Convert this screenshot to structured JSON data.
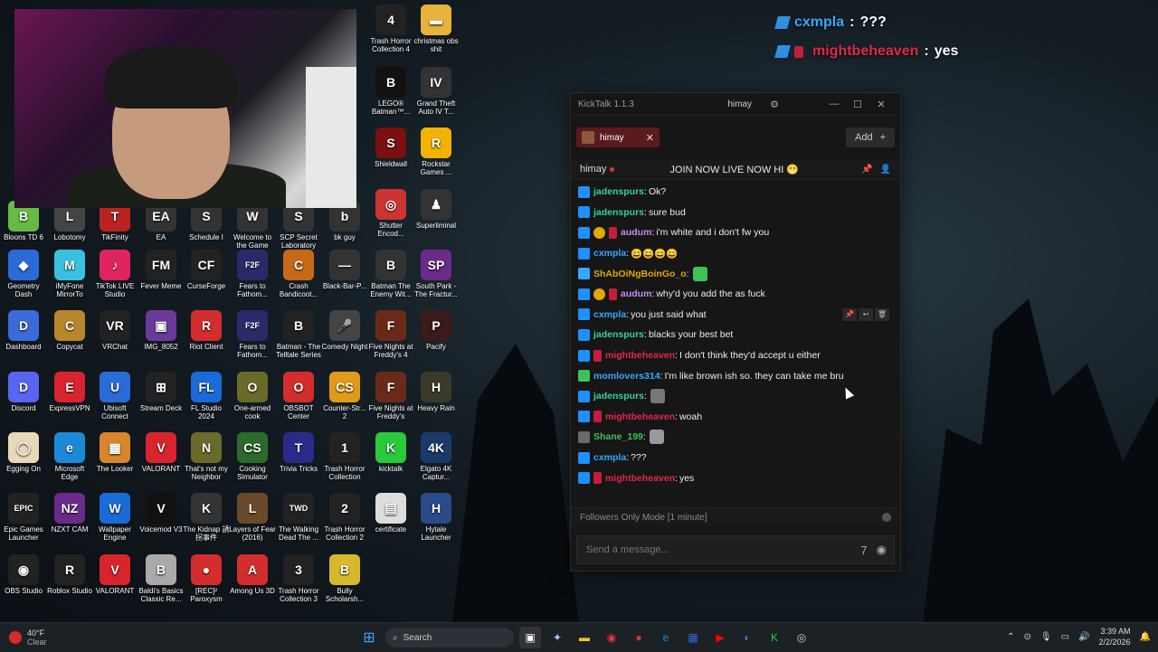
{
  "desktop_icons": [
    {
      "label": "Trash Horror Collection 4",
      "color": "#222",
      "glyph": "4"
    },
    {
      "label": "christmas obs shit",
      "color": "#e7b33a",
      "glyph": "▬"
    },
    {
      "label": "LEGO® Batman™...",
      "color": "#111",
      "glyph": "B"
    },
    {
      "label": "Grand Theft Auto IV T...",
      "color": "#333",
      "glyph": "IV"
    },
    {
      "label": "Shieldwall",
      "color": "#7a1010",
      "glyph": "S"
    },
    {
      "label": "Rockstar Games ...",
      "color": "#f2b300",
      "glyph": "R"
    },
    {
      "label": "Shutter Encod...",
      "color": "#c33",
      "glyph": "◎"
    },
    {
      "label": "Superliminal",
      "color": "#333",
      "glyph": "♟"
    },
    {
      "label": "Bloons TD 6",
      "color": "#6b4",
      "glyph": "B"
    },
    {
      "label": "Lobotomy",
      "color": "#444",
      "glyph": "L"
    },
    {
      "label": "TikFinity",
      "color": "#b22",
      "glyph": "T"
    },
    {
      "label": "EA",
      "color": "#333",
      "glyph": "EA"
    },
    {
      "label": "Schedule I",
      "color": "#333",
      "glyph": "S"
    },
    {
      "label": "Welcome to the Game",
      "color": "#333",
      "glyph": "W"
    },
    {
      "label": "SCP Secret Laboratory",
      "color": "#333",
      "glyph": "S"
    },
    {
      "label": "bk guy",
      "color": "#333",
      "glyph": "b"
    },
    {
      "label": "Geometry Dash",
      "color": "#2a6bd8",
      "glyph": "◆"
    },
    {
      "label": "iMyFone MirrorTo",
      "color": "#3ac0e0",
      "glyph": "M"
    },
    {
      "label": "TikTok LIVE Studio",
      "color": "#e0245e",
      "glyph": "♪"
    },
    {
      "label": "Fever Meme",
      "color": "#222",
      "glyph": "FM"
    },
    {
      "label": "CurseForge",
      "color": "#222",
      "glyph": "CF"
    },
    {
      "label": "Fears to Fathom...",
      "color": "#2a2a6a",
      "glyph": "F2F"
    },
    {
      "label": "Crash Bandicoot...",
      "color": "#c66a1a",
      "glyph": "C"
    },
    {
      "label": "Black-Bar-P...",
      "color": "#333",
      "glyph": "—"
    },
    {
      "label": "Batman The Enemy Wit...",
      "color": "#333",
      "glyph": "B"
    },
    {
      "label": "South Park - The Fractur...",
      "color": "#6a2a8a",
      "glyph": "SP"
    },
    {
      "label": "Dashboard",
      "color": "#3a6bd8",
      "glyph": "D"
    },
    {
      "label": "Copycat",
      "color": "#b8862b",
      "glyph": "C"
    },
    {
      "label": "VRChat",
      "color": "#222",
      "glyph": "VR"
    },
    {
      "label": "IMG_8052",
      "color": "#6a3a9a",
      "glyph": "▣"
    },
    {
      "label": "Riot Client",
      "color": "#d32d2d",
      "glyph": "R"
    },
    {
      "label": "Fears to Fathom...",
      "color": "#2a2a6a",
      "glyph": "F2F"
    },
    {
      "label": "Batman - The Telltale Series",
      "color": "#222",
      "glyph": "B"
    },
    {
      "label": "Comedy Night",
      "color": "#444",
      "glyph": "🎤"
    },
    {
      "label": "Five Nights at Freddy's 4",
      "color": "#6a2a1a",
      "glyph": "F"
    },
    {
      "label": "Pacify",
      "color": "#3a1a1a",
      "glyph": "P"
    },
    {
      "label": "Discord",
      "color": "#5865f2",
      "glyph": "D"
    },
    {
      "label": "ExpressVPN",
      "color": "#d8242c",
      "glyph": "E"
    },
    {
      "label": "Ubisoft Connect",
      "color": "#2a6bd8",
      "glyph": "U"
    },
    {
      "label": "Stream Deck",
      "color": "#222",
      "glyph": "⊞"
    },
    {
      "label": "FL Studio 2024",
      "color": "#1a6bd8",
      "glyph": "FL"
    },
    {
      "label": "One-armed cook",
      "color": "#6a6a2a",
      "glyph": "O"
    },
    {
      "label": "OBSBOT Center",
      "color": "#d32d2d",
      "glyph": "O"
    },
    {
      "label": "Counter-Str... 2",
      "color": "#e09a1a",
      "glyph": "CS"
    },
    {
      "label": "Five Nights at Freddy's",
      "color": "#6a2a1a",
      "glyph": "F"
    },
    {
      "label": "Heavy Rain",
      "color": "#3a3a2a",
      "glyph": "H"
    },
    {
      "label": "Egging On",
      "color": "#e8d8b8",
      "glyph": "◯"
    },
    {
      "label": "Microsoft Edge",
      "color": "#1a8ad8",
      "glyph": "e"
    },
    {
      "label": "The Looker",
      "color": "#d8862b",
      "glyph": "▦"
    },
    {
      "label": "VALORANT",
      "color": "#d8242c",
      "glyph": "V"
    },
    {
      "label": "That's not my Neighbor",
      "color": "#6a6a2a",
      "glyph": "N"
    },
    {
      "label": "Cooking Simulator",
      "color": "#2a6a2a",
      "glyph": "CS"
    },
    {
      "label": "Trivia Tricks",
      "color": "#2a2a8a",
      "glyph": "T"
    },
    {
      "label": "Trash Horror Collection",
      "color": "#222",
      "glyph": "1"
    },
    {
      "label": "kicktalk",
      "color": "#29c93a",
      "glyph": "K"
    },
    {
      "label": "Elgato 4K Captur...",
      "color": "#1a3a6a",
      "glyph": "4K"
    },
    {
      "label": "Epic Games Launcher",
      "color": "#222",
      "glyph": "EPIC"
    },
    {
      "label": "NZXT CAM",
      "color": "#6a2a8a",
      "glyph": "NZ"
    },
    {
      "label": "Wallpaper Engine",
      "color": "#1a6bd8",
      "glyph": "W"
    },
    {
      "label": "Voicemod V3",
      "color": "#111",
      "glyph": "V"
    },
    {
      "label": "The Kidnap 誘拐事件",
      "color": "#333",
      "glyph": "K"
    },
    {
      "label": "Layers of Fear (2016)",
      "color": "#6a4a2a",
      "glyph": "L"
    },
    {
      "label": "The Walking Dead The ...",
      "color": "#222",
      "glyph": "TWD"
    },
    {
      "label": "Trash Horror Collection 2",
      "color": "#222",
      "glyph": "2"
    },
    {
      "label": "certificate",
      "color": "#ddd",
      "glyph": "▤"
    },
    {
      "label": "Hytale Launcher",
      "color": "#2a4a8a",
      "glyph": "H"
    },
    {
      "label": "OBS Studio",
      "color": "#222",
      "glyph": "◉"
    },
    {
      "label": "Roblox Studio",
      "color": "#222",
      "glyph": "R"
    },
    {
      "label": "VALORANT",
      "color": "#d8242c",
      "glyph": "V"
    },
    {
      "label": "Baldi's Basics Classic Re...",
      "color": "#aaa",
      "glyph": "B"
    },
    {
      "label": "[REC]² Paroxysm",
      "color": "#d32d2d",
      "glyph": "●"
    },
    {
      "label": "Among Us 3D",
      "color": "#d32d2d",
      "glyph": "A"
    },
    {
      "label": "Trash Horror Collection 3",
      "color": "#222",
      "glyph": "3"
    },
    {
      "label": "Bully Scholarsh...",
      "color": "#d8b82b",
      "glyph": "B"
    }
  ],
  "overlay_chat": [
    {
      "user": "cxmpla",
      "text": "???",
      "color": "#35a8ff"
    },
    {
      "user": "mightbeheaven",
      "text": "yes",
      "color": "#e0284a"
    }
  ],
  "kicktalk": {
    "title": "KickTalk 1.1.3",
    "user": "himay",
    "tab_label": "himay",
    "add_label": "Add",
    "channel": "himay",
    "pinned": "JOIN NOW LIVE NOW HI 😁",
    "messages": [
      {
        "user": "jadenspurs",
        "text": "Ok?",
        "color": "#35d0a0",
        "badges": [
          "kick"
        ]
      },
      {
        "user": "jadenspurs",
        "text": "sure bud",
        "color": "#35d0a0",
        "badges": [
          "kick"
        ]
      },
      {
        "user": "audum",
        "text": "i'm white and i don't fw you",
        "color": "#c48df0",
        "badges": [
          "kick",
          "gold",
          "red"
        ]
      },
      {
        "user": "cxmpla",
        "text": "😄😄😄😄",
        "color": "#35a8ff",
        "badges": [
          "kick"
        ]
      },
      {
        "user": "ShAbOiNgBoinGo_o",
        "text": "",
        "color": "#e0a800",
        "badges": [
          "cyan"
        ],
        "emote": "#3ec256"
      },
      {
        "user": "audum",
        "text": "why'd you add the as fuck",
        "color": "#c48df0",
        "badges": [
          "kick",
          "gold",
          "red"
        ]
      },
      {
        "user": "cxmpla",
        "text": "you just said what",
        "color": "#35a8ff",
        "badges": [
          "kick"
        ]
      },
      {
        "user": "jadenspurs",
        "text": "blacks your best bet",
        "color": "#35d0a0",
        "badges": [
          "kick"
        ]
      },
      {
        "user": "mightbeheaven",
        "text": "I don't think they'd accept u either",
        "color": "#e0284a",
        "badges": [
          "kick",
          "red"
        ]
      },
      {
        "user": "momlovers314",
        "text": "I'm like brown ish so. they can take me bru",
        "color": "#35a8ff",
        "badges": [
          "green"
        ]
      },
      {
        "user": "jadenspurs",
        "text": "",
        "color": "#35d0a0",
        "badges": [
          "kick"
        ],
        "emote": "#777"
      },
      {
        "user": "mightbeheaven",
        "text": "woah",
        "color": "#e0284a",
        "badges": [
          "kick",
          "red"
        ]
      },
      {
        "user": "Shane_199",
        "text": "",
        "color": "#3ec256",
        "badges": [
          "grey"
        ],
        "emote": "#999"
      },
      {
        "user": "cxmpla",
        "text": "???",
        "color": "#35a8ff",
        "badges": [
          "kick"
        ]
      },
      {
        "user": "mightbeheaven",
        "text": "yes",
        "color": "#e0284a",
        "badges": [
          "kick",
          "red"
        ]
      }
    ],
    "followers_mode": "Followers Only Mode [1 minute]",
    "input_placeholder": "Send a message..."
  },
  "taskbar": {
    "temp": "40°F",
    "weather": "Clear",
    "search_label": "Search",
    "time": "3:39 AM",
    "date": "2/2/2026"
  }
}
